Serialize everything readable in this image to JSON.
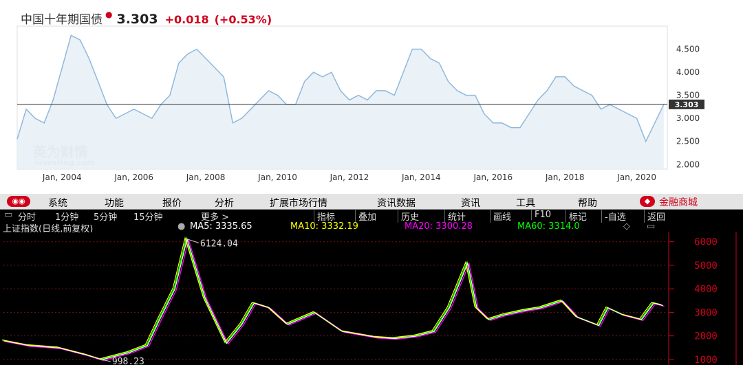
{
  "top": {
    "title": "中国十年期国债",
    "price": "3.303",
    "change": "+0.018",
    "change_pct": "(+0.53%)",
    "watermark_cn": "英为财情",
    "watermark_en": "Investing.com",
    "current_label": "3.303"
  },
  "bottom": {
    "menu": [
      "系统",
      "功能",
      "报价",
      "分析",
      "扩展市场行情",
      "资讯数据",
      "资讯",
      "工具",
      "帮助"
    ],
    "logo_text": "",
    "right_link": "金融商城",
    "toolbar_left": [
      "分时",
      "1分钟",
      "5分钟",
      "15分钟",
      "更多 >"
    ],
    "toolbar_right": [
      "指标",
      "叠加",
      "历史",
      "统计",
      "画线",
      "F10",
      "标记",
      "-自选",
      "返回"
    ],
    "index_name": "上证指数(日线,前复权)",
    "ma5": "MA5: 3335.65",
    "ma10": "MA10: 3332.19",
    "ma20": "MA20: 3300.28",
    "ma60": "MA60: 3314.0"
  },
  "colors": {
    "bond_line": "#8fb8dd",
    "bond_fill": "#e6eef6",
    "ma5": "#ffffff",
    "ma10": "#ffff00",
    "ma20": "#ff00ff",
    "ma60": "#00ff00",
    "axis_red": "#d0021b"
  },
  "chart_data": [
    {
      "type": "area",
      "title": "中国十年期国债",
      "x": [
        "2002-10",
        "2003-01",
        "2003-04",
        "2003-07",
        "2003-10",
        "2004-01",
        "2004-04",
        "2004-07",
        "2004-10",
        "2005-01",
        "2005-04",
        "2005-07",
        "2005-10",
        "2006-01",
        "2006-04",
        "2006-07",
        "2006-10",
        "2007-01",
        "2007-04",
        "2007-07",
        "2007-10",
        "2008-01",
        "2008-04",
        "2008-07",
        "2008-10",
        "2009-01",
        "2009-04",
        "2009-07",
        "2009-10",
        "2010-01",
        "2010-04",
        "2010-07",
        "2010-10",
        "2011-01",
        "2011-04",
        "2011-07",
        "2011-10",
        "2012-01",
        "2012-04",
        "2012-07",
        "2012-10",
        "2013-01",
        "2013-04",
        "2013-07",
        "2013-10",
        "2014-01",
        "2014-04",
        "2014-07",
        "2014-10",
        "2015-01",
        "2015-04",
        "2015-07",
        "2015-10",
        "2016-01",
        "2016-04",
        "2016-07",
        "2016-10",
        "2017-01",
        "2017-04",
        "2017-07",
        "2017-10",
        "2018-01",
        "2018-04",
        "2018-07",
        "2018-10",
        "2019-01",
        "2019-04",
        "2019-07",
        "2019-10",
        "2020-01",
        "2020-04",
        "2020-07",
        "2020-10"
      ],
      "y": [
        2.55,
        3.2,
        3.0,
        2.9,
        3.4,
        4.1,
        4.8,
        4.7,
        4.3,
        3.8,
        3.3,
        3.0,
        3.1,
        3.2,
        3.1,
        3.0,
        3.3,
        3.5,
        4.2,
        4.4,
        4.5,
        4.3,
        4.1,
        3.9,
        2.9,
        3.0,
        3.2,
        3.4,
        3.6,
        3.5,
        3.3,
        3.3,
        3.8,
        4.0,
        3.9,
        4.0,
        3.6,
        3.4,
        3.5,
        3.4,
        3.6,
        3.6,
        3.5,
        4.0,
        4.5,
        4.5,
        4.3,
        4.2,
        3.8,
        3.6,
        3.5,
        3.5,
        3.1,
        2.9,
        2.9,
        2.8,
        2.8,
        3.1,
        3.4,
        3.6,
        3.9,
        3.9,
        3.7,
        3.6,
        3.5,
        3.2,
        3.3,
        3.2,
        3.1,
        3.0,
        2.5,
        2.9,
        3.3
      ],
      "xticks": [
        "Jan, 2004",
        "Jan, 2006",
        "Jan, 2008",
        "Jan, 2010",
        "Jan, 2012",
        "Jan, 2014",
        "Jan, 2016",
        "Jan, 2018",
        "Jan, 2020"
      ],
      "yticks": [
        "4.500",
        "4.000",
        "3.500",
        "3.000",
        "2.500",
        "2.000"
      ],
      "ylim": [
        1.9,
        5.0
      ],
      "current": 3.303
    },
    {
      "type": "line",
      "title": "上证指数(日线,前复权)",
      "x": [
        "2002-10",
        "2003-06",
        "2004-04",
        "2005-01",
        "2005-06",
        "2006-03",
        "2006-09",
        "2007-01",
        "2007-06",
        "2007-10",
        "2008-04",
        "2008-11",
        "2009-04",
        "2009-08",
        "2010-01",
        "2010-07",
        "2011-04",
        "2012-01",
        "2012-12",
        "2013-06",
        "2014-01",
        "2014-07",
        "2014-12",
        "2015-06",
        "2015-09",
        "2016-01",
        "2016-06",
        "2017-01",
        "2017-06",
        "2018-01",
        "2018-06",
        "2019-01",
        "2019-04",
        "2019-09",
        "2020-03",
        "2020-07",
        "2020-10"
      ],
      "series": [
        {
          "values": [
            1800,
            1600,
            1500,
            1200,
            998,
            1300,
            1600,
            2700,
            4000,
            6124,
            3600,
            1700,
            2500,
            3400,
            3200,
            2500,
            3000,
            2200,
            1950,
            1900,
            2000,
            2200,
            3200,
            5100,
            3200,
            2700,
            2900,
            3100,
            3200,
            3500,
            2800,
            2450,
            3200,
            2900,
            2700,
            3400,
            3300
          ]
        }
      ],
      "annotations": [
        "6124.04",
        "998.23"
      ],
      "yticks": [
        "6000",
        "5000",
        "4000",
        "3000",
        "2000",
        "1000"
      ],
      "ylim": [
        850,
        6400
      ]
    }
  ]
}
